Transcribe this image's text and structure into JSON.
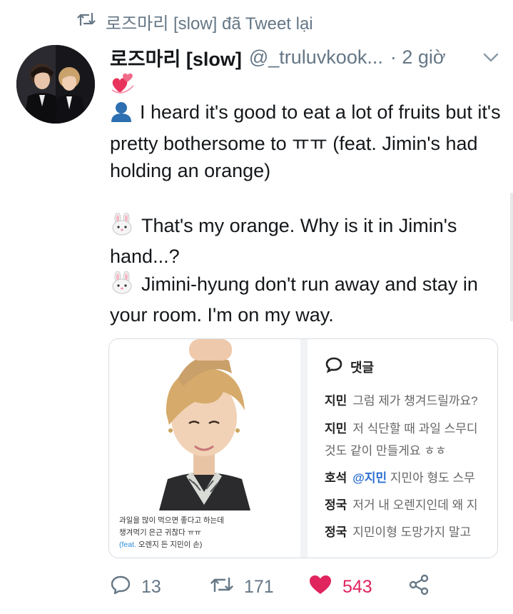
{
  "retweet_banner": {
    "icon": "retweet-icon",
    "text": "로즈마리 [slow] đã Tweet lại"
  },
  "tweet": {
    "author_name": "로즈마리 [slow]",
    "handle": "@_truluvkook...",
    "time": "· 2 giờ",
    "top_emoji": "revolving-hearts-emoji",
    "paragraphs": [
      {
        "emoji": "bust-silhouette-emoji",
        "text": "I heard it's good to eat a lot of fruits but it's pretty bothersome to ㅠㅠ (feat. Jimin's had holding an orange)"
      },
      {
        "emoji": "rabbit-face-emoji",
        "text": "That's my orange. Why is it in Jimin's hand...?"
      },
      {
        "emoji": "rabbit-face-emoji",
        "text": "Jimini-hyung don't run away and stay in your room. I'm on my way."
      }
    ]
  },
  "media": {
    "photo_caption": {
      "line1": "과일을 많이 먹으면 좋다고 하는데",
      "line2": "챙겨먹기 은근 귀찮다 ㅠㅠ",
      "feat_label": "(feat.",
      "feat_rest": " 오렌지 든 지민이 손)"
    },
    "comments_title": "댓글",
    "comments": [
      {
        "author": "지민",
        "text": "그럼 제가 챙겨드릴까요?"
      },
      {
        "author": "지민",
        "text": "저 식단할 때 과일 스무디"
      },
      {
        "author": "",
        "text": "것도 같이 만들게요 ㅎㅎ"
      },
      {
        "author": "호석",
        "mention": "@지민",
        "text": " 지민아 형도 스무"
      },
      {
        "author": "정국",
        "text": "저거 내 오렌지인데 왜 지"
      },
      {
        "author": "정국",
        "text": "지민이형 도망가지 말고"
      }
    ]
  },
  "actions": {
    "reply_count": "13",
    "retweet_count": "171",
    "like_count": "543",
    "like_color": "#e0245e",
    "muted_color": "#657786"
  }
}
